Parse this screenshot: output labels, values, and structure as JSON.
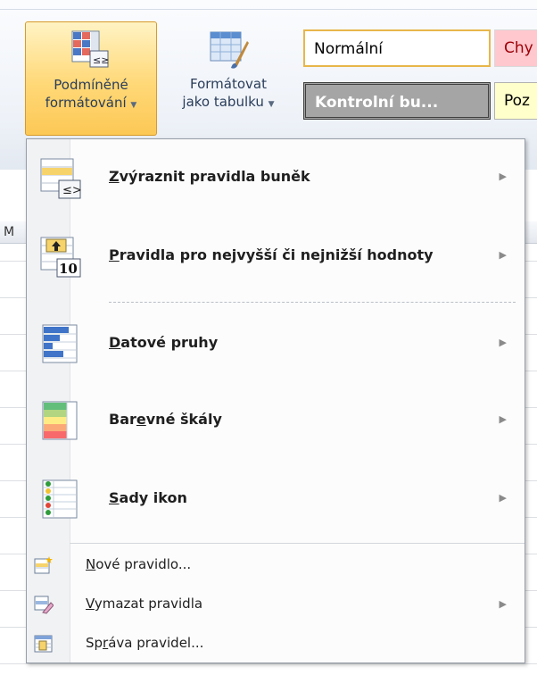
{
  "ribbon": {
    "conditional_formatting": {
      "line1": "Podmíněné",
      "line2": "formátování"
    },
    "format_as_table": {
      "line1": "Formátovat",
      "line2": "jako tabulku"
    },
    "cell_styles": {
      "normal": "Normální",
      "bad": "Chy",
      "check_cell": "Kontrolní bu...",
      "note": "Poz"
    }
  },
  "sheet": {
    "column_header": "M"
  },
  "menu": {
    "highlight_rules": {
      "key": "Z",
      "rest": "výraznit pravidla buněk"
    },
    "top_bottom_rules": {
      "key": "P",
      "rest": "ravidla pro nejvyšší či nejnižší hodnoty"
    },
    "data_bars": {
      "key": "D",
      "rest": "atové pruhy"
    },
    "color_scales": {
      "pre": "Bar",
      "key": "e",
      "rest": "vné škály"
    },
    "icon_sets": {
      "key": "S",
      "rest": "ady ikon"
    },
    "new_rule": {
      "key": "N",
      "rest": "ové pravidlo..."
    },
    "clear_rules": {
      "key": "V",
      "rest": "ymazat pravidla"
    },
    "manage_rules": {
      "pre": "Sp",
      "key": "r",
      "rest": "áva pravidel..."
    },
    "submenu_arrow": "▶",
    "dropdown_caret": "▼"
  }
}
